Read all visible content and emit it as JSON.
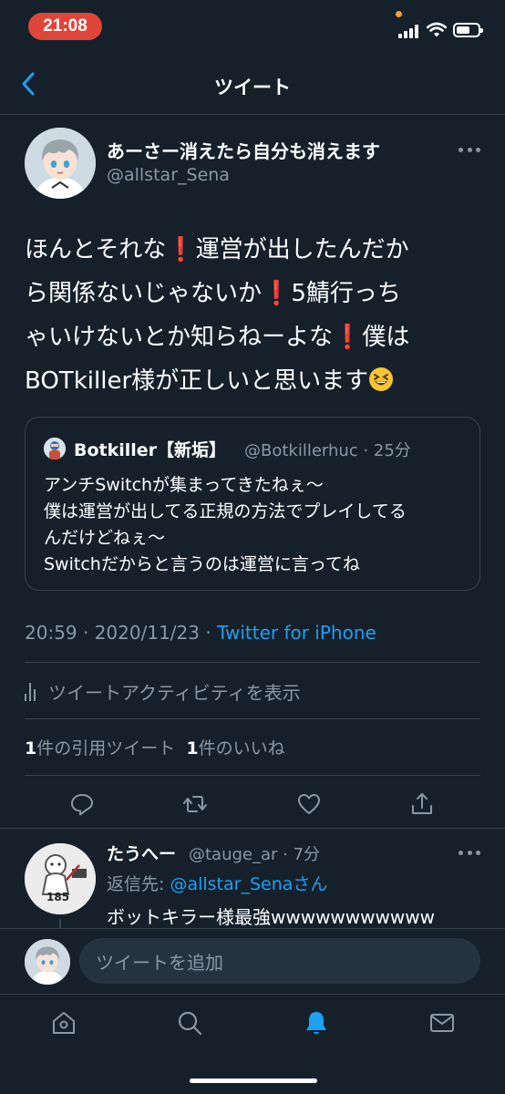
{
  "status_bar": {
    "time": "21:08"
  },
  "header": {
    "title": "ツイート"
  },
  "tweet": {
    "author": {
      "display_name": "あーさー消えたら自分も消えます",
      "handle": "@allstar_Sena"
    },
    "text_lines": [
      [
        "ほんとそれな",
        "❗",
        "運営が出したんだか"
      ],
      [
        "ら関係ないじゃないか",
        "❗",
        "5鯖行っち"
      ],
      [
        "ゃいけないとか知らねーよな",
        "❗",
        "僕は"
      ],
      [
        "BOTkiller様が正しいと思います",
        "😆",
        ""
      ]
    ],
    "quote": {
      "display_name": "Botkiller【新垢】",
      "handle_time": "@Botkillerhuc · 25分",
      "lines": [
        "アンチSwitchが集まってきたねぇ〜",
        "僕は運営が出してる正規の方法でプレイしてる",
        "んだけどねぇ〜",
        "Switchだからと言うのは運営に言ってね"
      ]
    },
    "timestamp": "20:59 · 2020/11/23 · ",
    "source": "Twitter for iPhone",
    "activity_label": "ツイートアクティビティを表示",
    "quote_count": "1",
    "quote_label": "件の引用ツイート",
    "like_count": "1",
    "like_label": "件のいいね"
  },
  "reply": {
    "display_name": "たうへー",
    "handle_time": "@tauge_ar · 7分",
    "reply_to_prefix": "返信先: ",
    "reply_to_mention": "@allstar_Senaさん",
    "text": "ボットキラー様最強wwwwwwwwwww",
    "avatar_badge": "185"
  },
  "composer": {
    "placeholder": "ツイートを追加"
  },
  "icons": {
    "actions": [
      "reply-icon",
      "retweet-icon",
      "like-icon",
      "share-icon"
    ],
    "tabs": [
      "home-icon",
      "search-icon",
      "notifications-icon",
      "messages-icon"
    ]
  },
  "colors": {
    "background": "#15202b",
    "accent": "#1da1f2",
    "muted": "#8899a6",
    "time_pill": "#e0453a"
  }
}
